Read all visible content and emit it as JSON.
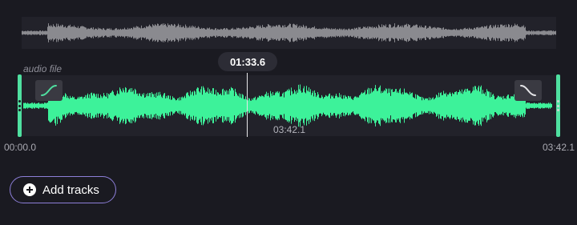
{
  "editor": {
    "track_name": "audio file",
    "playhead_time": "01:33.6",
    "clip_duration": "03:42.1",
    "ruler_start": "00:00.0",
    "ruler_end": "03:42.1",
    "playhead_fraction": 0.42
  },
  "actions": {
    "add_tracks_label": "Add tracks",
    "add_tracks_icon": "plus-circle-icon",
    "fade_in_icon": "fade-in-curve-icon",
    "fade_out_icon": "fade-out-curve-icon"
  },
  "colors": {
    "background": "#1a1a21",
    "waveform_active": "#3df29a",
    "waveform_overview": "#8a8a8f",
    "trim_handle": "#4fe0a0",
    "button_border": "#8d7fd9"
  }
}
